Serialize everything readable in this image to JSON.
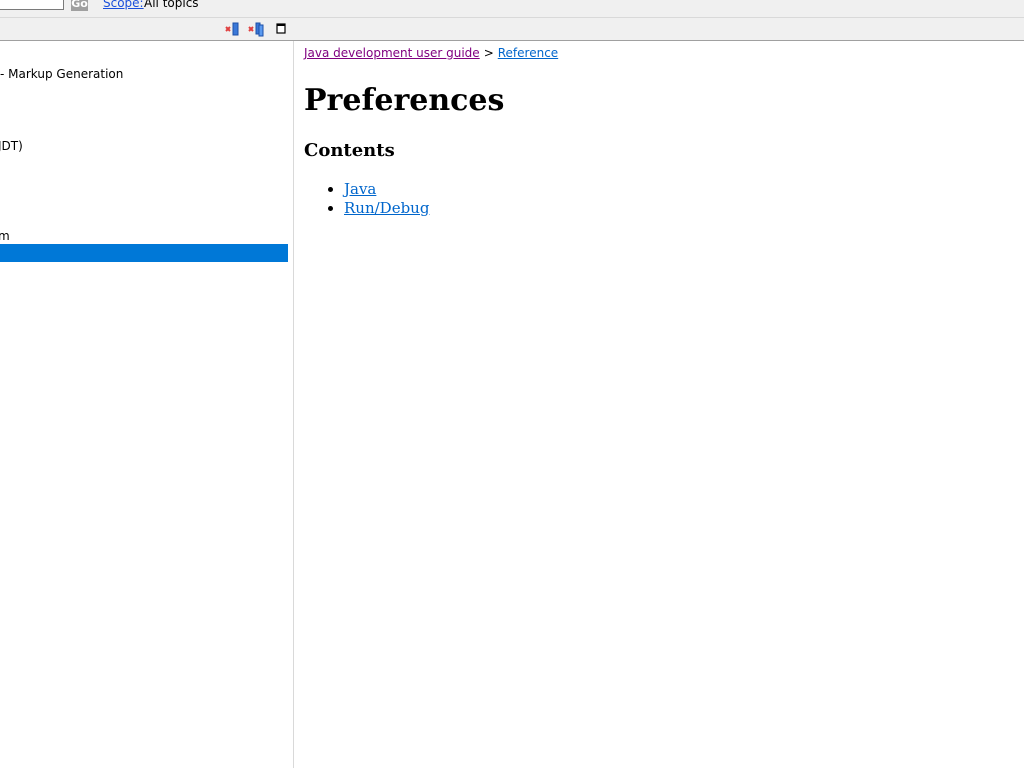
{
  "search": {
    "value": "",
    "go_label": "Go",
    "scope_label": "Scope:",
    "scope_value": "All topics"
  },
  "toolbar": {
    "icons": [
      "remove-filter-icon",
      "remove-all-filter-icon",
      "maximize-icon"
    ]
  },
  "left_tree": {
    "items": [
      "- Markup Generation",
      "JDT)",
      "m"
    ],
    "selected_color": "#0078d7"
  },
  "content": {
    "breadcrumb": {
      "guide": "Java development user guide",
      "separator": ">",
      "reference": "Reference"
    },
    "title": "Preferences",
    "contents_heading": "Contents",
    "links": [
      "Java",
      "Run/Debug"
    ]
  },
  "colors": {
    "link": "#0066cc",
    "visited_link": "#800080",
    "selection": "#0078d7"
  }
}
